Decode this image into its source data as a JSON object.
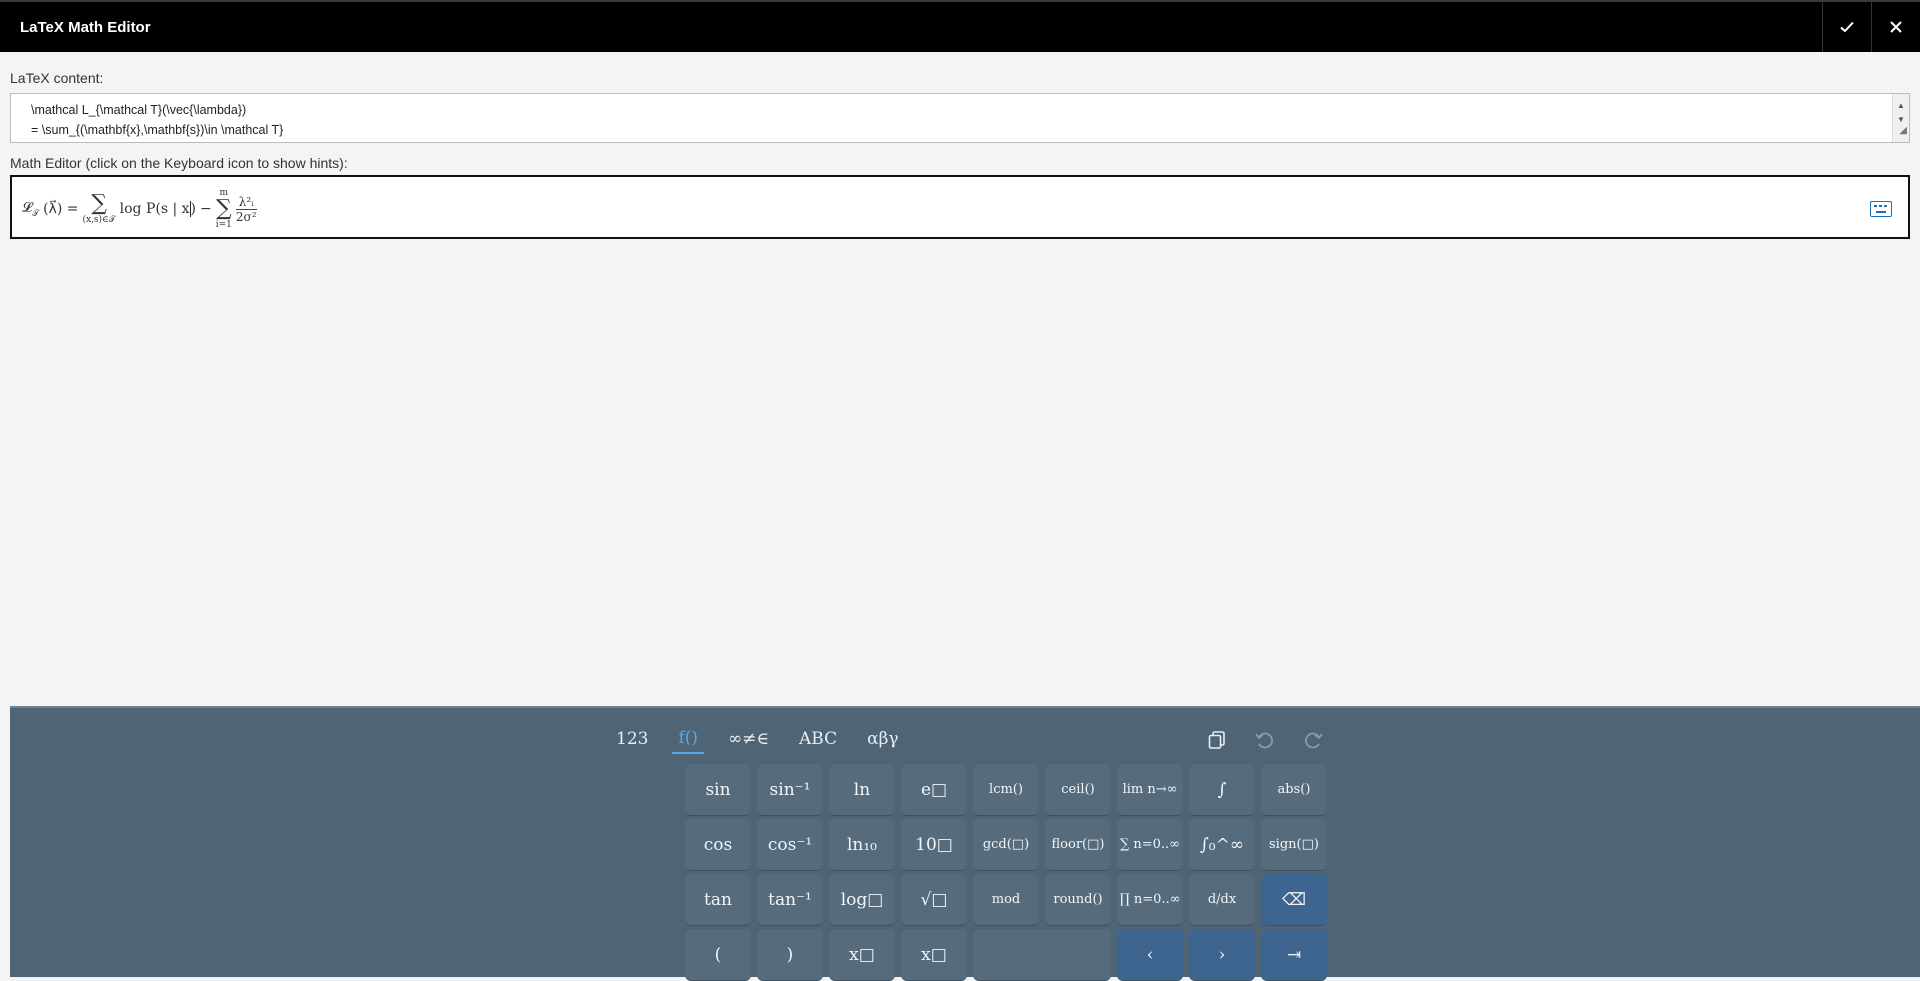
{
  "window": {
    "title": "LaTeX Math Editor"
  },
  "latex": {
    "label": "LaTeX content:",
    "lines": [
      "\\mathcal L_{\\mathcal T}(\\vec{\\lambda})",
      "= \\sum_{(\\mathbf{x},\\mathbf{s})\\in \\mathcal T}"
    ]
  },
  "editor": {
    "label": "Math Editor (click on the Keyboard icon to show hints):",
    "expr": {
      "lhs": "𝓛",
      "lhs_sub": "𝒯",
      "arg": "(λ⃗) =",
      "sum1": "∑",
      "sum1_below": "(x,s)∈𝒯",
      "term": "log P(s | x",
      "term_close": ")",
      "minus": "−",
      "sum2_above": "m",
      "sum2": "∑",
      "sum2_below": "i=1",
      "frac_num": "λ²ᵢ",
      "frac_den": "2σ²"
    }
  },
  "keyboard": {
    "tabs": [
      "123",
      "f()",
      "∞≠∈",
      "ABC",
      "αβγ"
    ],
    "active_tab": "f()",
    "keys": [
      "sin",
      "sin⁻¹",
      "ln",
      "e□",
      "lcm()",
      "ceil()",
      "lim n→∞",
      "∫",
      "abs()",
      "cos",
      "cos⁻¹",
      "ln₁₀",
      "10□",
      "gcd(□)",
      "floor(□)",
      "∑ n=0..∞",
      "∫₀^∞",
      "sign(□)",
      "tan",
      "tan⁻¹",
      "log□",
      "√□",
      "mod",
      "round()",
      "∏ n=0..∞",
      "d/dx",
      "⌫",
      "(",
      ")",
      "x□",
      "x□",
      "",
      "‹",
      "›",
      "⇥"
    ]
  }
}
